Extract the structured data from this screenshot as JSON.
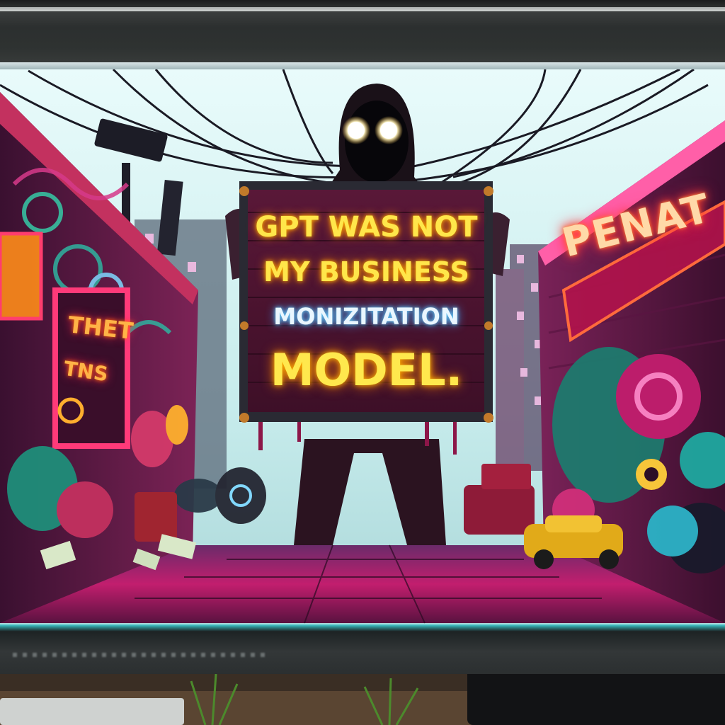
{
  "sign": {
    "line1": "GPT WAS NOT",
    "line2": "MY BUSINESS",
    "line3": "MONIZITATION",
    "line4": "MODEL."
  },
  "neon_right": {
    "text": "PENAT"
  },
  "neon_left": {
    "line1": "THET",
    "line2": "TNS"
  },
  "colors": {
    "sign_text": "#ffe64a",
    "sign_highlight": "#e9f6ff",
    "neon_pink": "#ff2b6a",
    "sky": "#cfeff0",
    "wall_magenta": "#8a1f5c"
  }
}
